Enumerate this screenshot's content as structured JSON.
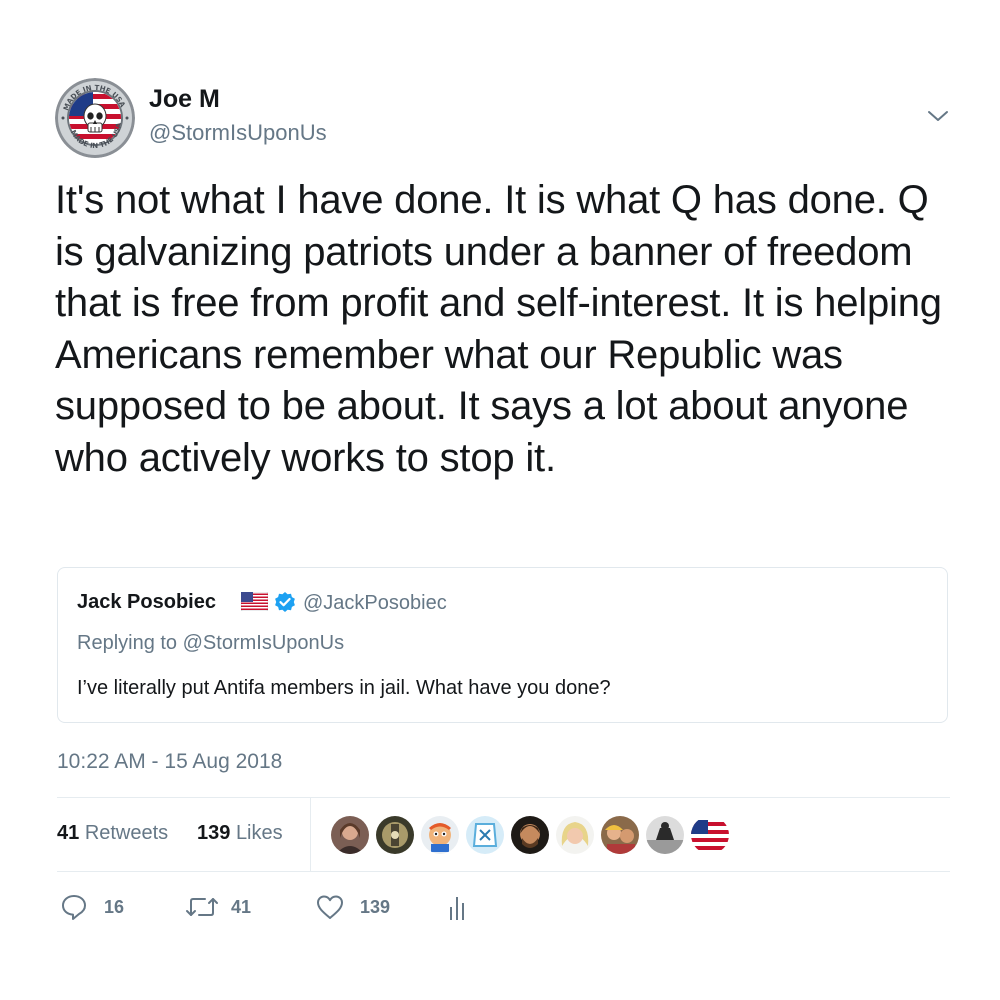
{
  "author": {
    "name": "Joe M",
    "handle": "@StormIsUponUs",
    "avatar_icon": "made-in-usa-punisher-badge",
    "avatar_badge_text_top": "MADE IN THE USA",
    "avatar_badge_text_bottom": "MADE IN THE USA"
  },
  "menu_icon": "chevron-down-icon",
  "tweet": {
    "text": "It's not what I have done. It is what Q has done. Q is galvanizing patriots under a banner of freedom that is free from profit and self-interest. It is helping Americans remember what our Republic was supposed to be about. It says a lot about anyone who actively works to stop it."
  },
  "quoted_tweet": {
    "name": "Jack Posobiec",
    "flag_icon": "us-flag-emoji",
    "verified_icon": "verified-badge-icon",
    "handle": "@JackPosobiec",
    "replying_to": "Replying to @StormIsUponUs",
    "text": "I’ve literally put Antifa members in jail. What have you done?"
  },
  "timestamp": "10:22 AM - 15 Aug 2018",
  "stats": {
    "retweets_count": "41",
    "retweets_label": "Retweets",
    "likes_count": "139",
    "likes_label": "Likes"
  },
  "likers": [
    {
      "icon": "liker-avatar-1"
    },
    {
      "icon": "liker-avatar-2"
    },
    {
      "icon": "liker-avatar-3"
    },
    {
      "icon": "liker-avatar-4"
    },
    {
      "icon": "liker-avatar-5"
    },
    {
      "icon": "liker-avatar-6"
    },
    {
      "icon": "liker-avatar-7"
    },
    {
      "icon": "liker-avatar-8"
    },
    {
      "icon": "liker-avatar-9-us-flag"
    }
  ],
  "actions": {
    "reply_count": "16",
    "retweet_count": "41",
    "like_count": "139",
    "analytics_icon": "bar-chart-icon"
  },
  "colors": {
    "text_primary": "#14171a",
    "text_secondary": "#657786",
    "border": "#e1e8ed",
    "verified_blue": "#1da1f2"
  }
}
